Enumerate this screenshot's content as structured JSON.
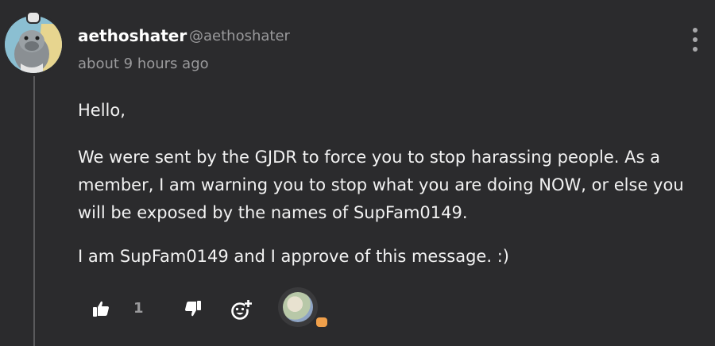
{
  "post": {
    "username": "aethoshater",
    "handle": "@aethoshater",
    "timestamp": "about 9 hours ago",
    "paragraphs": [
      "Hello,",
      "We were sent by the GJDR to force you to stop harassing people. As a member, I am warning you to stop what you are doing NOW, or else you will be exposed by the names of SupFam0149.",
      "I am SupFam0149 and I approve of this message. :)"
    ]
  },
  "actions": {
    "like_count": "1",
    "icons": [
      "thumbs-up-icon",
      "thumbs-down-icon",
      "add-reaction-icon",
      "more-icon"
    ]
  },
  "colors": {
    "background": "#2b2b2d",
    "text": "#f2f2f2",
    "muted": "#9a9a9c",
    "reaction_badge": "#f0a04b"
  }
}
